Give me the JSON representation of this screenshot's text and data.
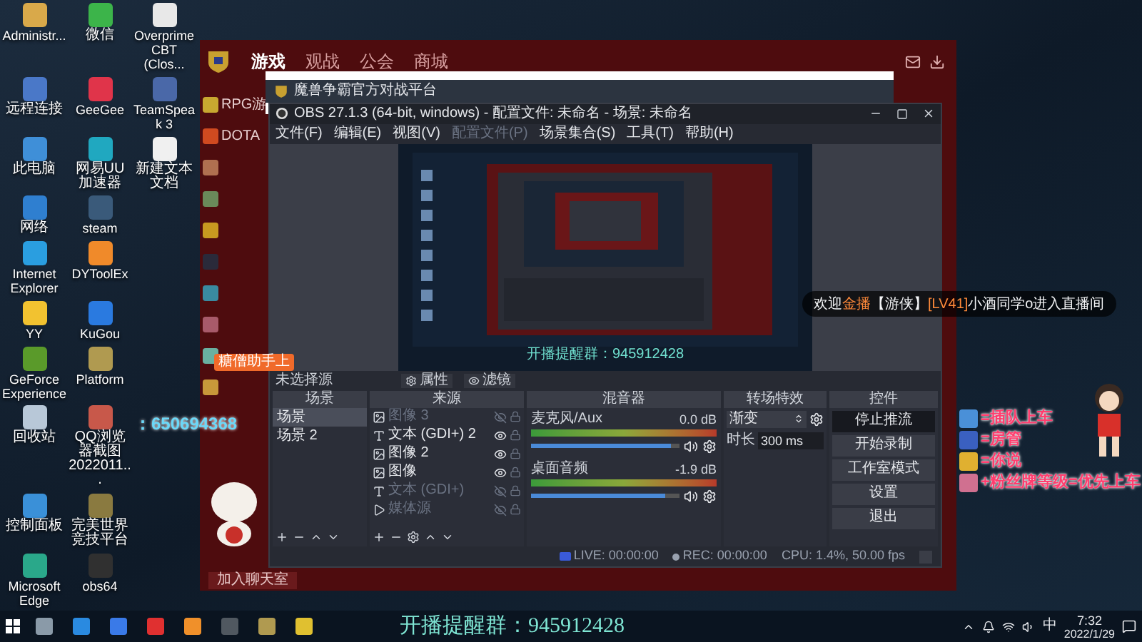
{
  "desktop": {
    "columns": [
      {
        "icons": [
          {
            "label": "Administr...",
            "color": "#d9a94a"
          },
          {
            "label": "远程连接",
            "color": "#4a78c8"
          },
          {
            "label": "此电脑",
            "color": "#3f8fd8"
          },
          {
            "label": "网络",
            "color": "#2f7fd0"
          },
          {
            "label": "Internet Explorer",
            "color": "#2a9ee0"
          },
          {
            "label": "YY",
            "color": "#f2c230"
          },
          {
            "label": "GeForce Experience",
            "color": "#5a9a2a"
          },
          {
            "label": "回收站",
            "color": "#b8c8d8"
          },
          {
            "label": "控制面板",
            "color": "#3a90d8"
          },
          {
            "label": "Microsoft Edge",
            "color": "#2aa88a"
          }
        ]
      },
      {
        "icons": [
          {
            "label": "微信",
            "color": "#3cb44a"
          },
          {
            "label": "GeeGee",
            "color": "#e0344a"
          },
          {
            "label": "网易UU加速器",
            "color": "#20a8c0"
          },
          {
            "label": "steam",
            "color": "#3a5a7a"
          },
          {
            "label": "DYToolEx",
            "color": "#f08a2a"
          },
          {
            "label": "KuGou",
            "color": "#2a7ae0"
          },
          {
            "label": "Platform",
            "color": "#b09a50"
          },
          {
            "label": "QQ浏览器截图2022011...",
            "color": "#c8584a"
          },
          {
            "label": "完美世界竞技平台",
            "color": "#8a7a40"
          },
          {
            "label": "obs64",
            "color": "#303030"
          }
        ]
      },
      {
        "icons": [
          {
            "label": "Overprime CBT (Clos...",
            "color": "#e8e8e8"
          },
          {
            "label": "TeamSpeak 3",
            "color": "#4a68a8"
          },
          {
            "label": "新建文本文档",
            "color": "#f0f0f0"
          }
        ]
      }
    ],
    "qq_number": "：650694368"
  },
  "platform_window": {
    "nav": [
      {
        "label": "游戏",
        "selected": true
      },
      {
        "label": "观战",
        "selected": false
      },
      {
        "label": "公会",
        "selected": false
      },
      {
        "label": "商城",
        "selected": false
      }
    ],
    "sidebar": [
      {
        "label": "RPG游",
        "color": "#c8a830"
      },
      {
        "label": "DOTA",
        "color": "#d04a20"
      },
      {
        "color": "#b07050"
      },
      {
        "color": "#6a8a5a"
      },
      {
        "color": "#c89a20"
      },
      {
        "color": "#2a2a3a"
      },
      {
        "color": "#3a8aa0"
      },
      {
        "color": "#a85a6a"
      },
      {
        "color": "#6ab0a0"
      },
      {
        "color": "#c8983a"
      }
    ],
    "tooltip": "糖僧助手上",
    "chat_button": "加入聊天室"
  },
  "background_window": {
    "title": "魔兽争霸官方对战平台"
  },
  "obs": {
    "title": "OBS 27.1.3 (64-bit, windows) - 配置文件: 未命名 - 场景: 未命名",
    "menu": [
      {
        "label": "文件(F)",
        "disabled": false
      },
      {
        "label": "编辑(E)",
        "disabled": false
      },
      {
        "label": "视图(V)",
        "disabled": false
      },
      {
        "label": "配置文件(P)",
        "disabled": true
      },
      {
        "label": "场景集合(S)",
        "disabled": false
      },
      {
        "label": "工具(T)",
        "disabled": false
      },
      {
        "label": "帮助(H)",
        "disabled": false
      }
    ],
    "preview": {
      "caption": "开播提醒群：945912428"
    },
    "source_bar": {
      "label": "未选择源",
      "properties": "属性",
      "filters": "滤镜"
    },
    "scenes": {
      "title": "场景",
      "items": [
        {
          "label": "场景",
          "selected": true
        },
        {
          "label": "场景 2",
          "selected": false
        }
      ]
    },
    "sources": {
      "title": "来源",
      "items": [
        {
          "label": "图像 3",
          "kind": "image",
          "visible": false
        },
        {
          "label": "文本 (GDI+) 2",
          "kind": "text",
          "visible": true
        },
        {
          "label": "图像 2",
          "kind": "image",
          "visible": true
        },
        {
          "label": "图像",
          "kind": "image",
          "visible": true
        },
        {
          "label": "文本 (GDI+)",
          "kind": "text",
          "visible": false
        },
        {
          "label": "媒体源",
          "kind": "media",
          "visible": false
        }
      ]
    },
    "mixer": {
      "title": "混音器",
      "channels": [
        {
          "name": "麦克风/Aux",
          "reading": "0.0 dB",
          "level": 0.94
        },
        {
          "name": "桌面音频",
          "reading": "-1.9 dB",
          "level": 0.9
        }
      ]
    },
    "transitions": {
      "title": "转场特效",
      "type": "渐变",
      "duration_label": "时长",
      "duration": "300 ms"
    },
    "controls": {
      "title": "控件",
      "buttons": [
        {
          "label": "停止推流",
          "active": true
        },
        {
          "label": "开始录制",
          "active": false
        },
        {
          "label": "工作室模式",
          "active": false
        },
        {
          "label": "设置",
          "active": false
        },
        {
          "label": "退出",
          "active": false
        }
      ]
    },
    "status": {
      "live": "LIVE: 00:00:00",
      "rec": "REC: 00:00:00",
      "cpu": "CPU: 1.4%, 50.00 fps"
    }
  },
  "overlay": {
    "notification": [
      {
        "text": "欢迎",
        "kind": "plain"
      },
      {
        "text": "金播",
        "kind": "highlight"
      },
      {
        "text": "【游侠】",
        "kind": "plain"
      },
      {
        "text": "[LV41]",
        "kind": "highlight"
      },
      {
        "text": "小酒同学o进入直播间",
        "kind": "plain"
      }
    ],
    "stickers": [
      {
        "text": "=插队上车",
        "color": "#4a90d8"
      },
      {
        "text": "=房管",
        "color": "#3a60c0"
      },
      {
        "text": "=你说",
        "color": "#e0b030"
      },
      {
        "text": "+粉丝牌等级=优先上车",
        "color": "#d07090"
      }
    ]
  },
  "taskbar": {
    "apps": [
      {
        "color": "#8a9aa8"
      },
      {
        "color": "#2a8ae0"
      },
      {
        "color": "#3a7ae8"
      },
      {
        "color": "#e03030"
      },
      {
        "color": "#f0902a"
      },
      {
        "color": "#505860"
      },
      {
        "color": "#b09a50"
      },
      {
        "color": "#e0c030"
      }
    ],
    "banner": "开播提醒群：945912428",
    "ime": "中",
    "time": "7:32",
    "date": "2022/1/29"
  }
}
